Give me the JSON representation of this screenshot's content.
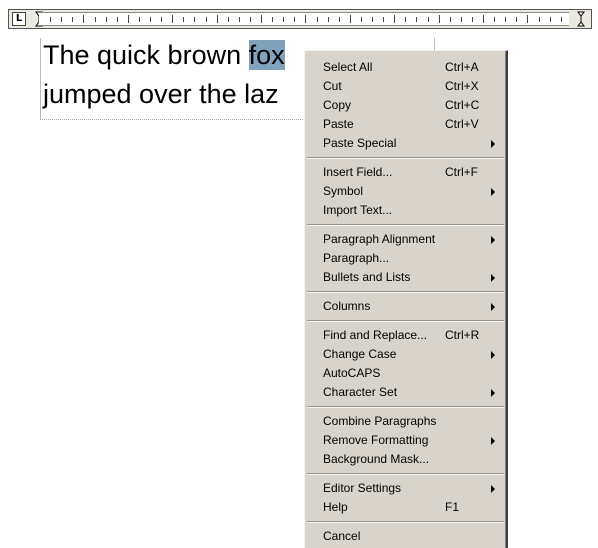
{
  "ruler": {
    "tab_selector": "L"
  },
  "editor": {
    "line1": {
      "before": "The quick brown ",
      "selected": "fox",
      "after": ""
    },
    "line2": "jumped over the laz"
  },
  "context_menu": {
    "items": [
      {
        "label": "Select All",
        "shortcut": "Ctrl+A"
      },
      {
        "label": "Cut",
        "shortcut": "Ctrl+X"
      },
      {
        "label": "Copy",
        "shortcut": "Ctrl+C"
      },
      {
        "label": "Paste",
        "shortcut": "Ctrl+V"
      },
      {
        "label": "Paste Special",
        "submenu": true
      },
      {
        "label": "Insert Field...",
        "shortcut": "Ctrl+F"
      },
      {
        "label": "Symbol",
        "submenu": true
      },
      {
        "label": "Import Text..."
      },
      {
        "label": "Paragraph Alignment",
        "submenu": true
      },
      {
        "label": "Paragraph..."
      },
      {
        "label": "Bullets and Lists",
        "submenu": true
      },
      {
        "label": "Columns",
        "submenu": true
      },
      {
        "label": "Find and Replace...",
        "shortcut": "Ctrl+R"
      },
      {
        "label": "Change Case",
        "submenu": true
      },
      {
        "label": "AutoCAPS"
      },
      {
        "label": "Character Set",
        "submenu": true
      },
      {
        "label": "Combine Paragraphs"
      },
      {
        "label": "Remove Formatting",
        "submenu": true
      },
      {
        "label": "Background Mask..."
      },
      {
        "label": "Editor Settings",
        "submenu": true
      },
      {
        "label": "Help",
        "shortcut": "F1"
      },
      {
        "label": "Cancel"
      }
    ]
  },
  "colors": {
    "selection": "#7fa2bd",
    "menu_bg": "#d8d4cb"
  },
  "icons": [
    "tab-selector-icon",
    "first-line-indent-icon",
    "right-indent-icon",
    "submenu-arrow-icon"
  ]
}
